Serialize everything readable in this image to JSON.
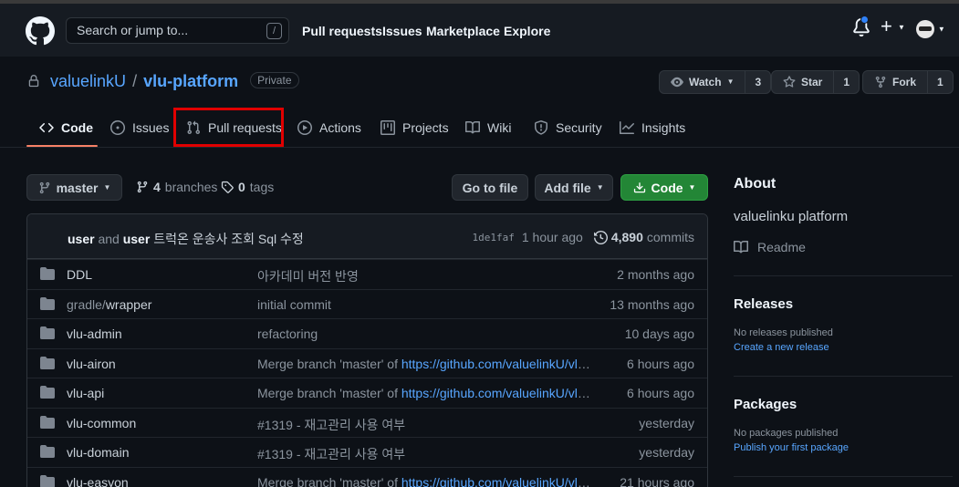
{
  "header": {
    "search_placeholder": "Search or jump to...",
    "search_shortcut": "/",
    "nav": [
      "Pull requests",
      "Issues",
      "Marketplace",
      "Explore"
    ]
  },
  "repo": {
    "owner": "valuelinkU",
    "separator": "/",
    "name": "vlu-platform",
    "visibility": "Private",
    "watch_label": "Watch",
    "watch_count": "3",
    "star_label": "Star",
    "star_count": "1",
    "fork_label": "Fork",
    "fork_count": "1"
  },
  "tabs": [
    {
      "label": "Code",
      "icon": "code-icon",
      "active": true
    },
    {
      "label": "Issues",
      "icon": "issue-icon"
    },
    {
      "label": "Pull requests",
      "icon": "pull-request-icon",
      "highlighted": true
    },
    {
      "label": "Actions",
      "icon": "play-icon"
    },
    {
      "label": "Projects",
      "icon": "project-icon"
    },
    {
      "label": "Wiki",
      "icon": "book-icon"
    },
    {
      "label": "Security",
      "icon": "shield-icon"
    },
    {
      "label": "Insights",
      "icon": "graph-icon"
    }
  ],
  "toolbar": {
    "branch": "master",
    "branches_count": "4",
    "branches_label": "branches",
    "tags_count": "0",
    "tags_label": "tags",
    "go_to_file": "Go to file",
    "add_file": "Add file",
    "code": "Code"
  },
  "commit": {
    "author1": "user",
    "and": "and",
    "author2": "user",
    "message": "트럭온 운송사 조회 Sql 수정",
    "sha": "1de1faf",
    "time": "1 hour ago",
    "commits_count": "4,890",
    "commits_label": "commits"
  },
  "files": [
    {
      "name": "DDL",
      "message": "아카데미 버전 반영",
      "link": "",
      "time": "2 months ago"
    },
    {
      "name_prefix": "gradle/",
      "name": "wrapper",
      "message": "initial commit",
      "link": "",
      "time": "13 months ago"
    },
    {
      "name": "vlu-admin",
      "message": "refactoring",
      "link": "",
      "time": "10 days ago"
    },
    {
      "name": "vlu-airon",
      "message": "Merge branch 'master' of ",
      "link": "https://github.com/valuelinkU/vlu-platf...",
      "time": "6 hours ago"
    },
    {
      "name": "vlu-api",
      "message": "Merge branch 'master' of ",
      "link": "https://github.com/valuelinkU/vlu-platf...",
      "time": "6 hours ago"
    },
    {
      "name": "vlu-common",
      "message": "#1319 - 재고관리 사용 여부",
      "link": "",
      "time": "yesterday"
    },
    {
      "name": "vlu-domain",
      "message": "#1319 - 재고관리 사용 여부",
      "link": "",
      "time": "yesterday"
    },
    {
      "name": "vlu-easyon",
      "message": "Merge branch 'master' of ",
      "link": "https://github.com/valuelinkU/vlu-platf...",
      "time": "21 hours ago"
    }
  ],
  "sidebar": {
    "about_title": "About",
    "description": "valuelinku platform",
    "readme": "Readme",
    "releases_title": "Releases",
    "releases_none": "No releases published",
    "releases_link": "Create a new release",
    "packages_title": "Packages",
    "packages_none": "No packages published",
    "packages_link": "Publish your first package"
  },
  "colors": {
    "background": "#0d1117",
    "header": "#161b22",
    "link": "#58a6ff",
    "green_button": "#238636",
    "active_tab_underline": "#f78166",
    "highlight_box": "#e00000"
  }
}
